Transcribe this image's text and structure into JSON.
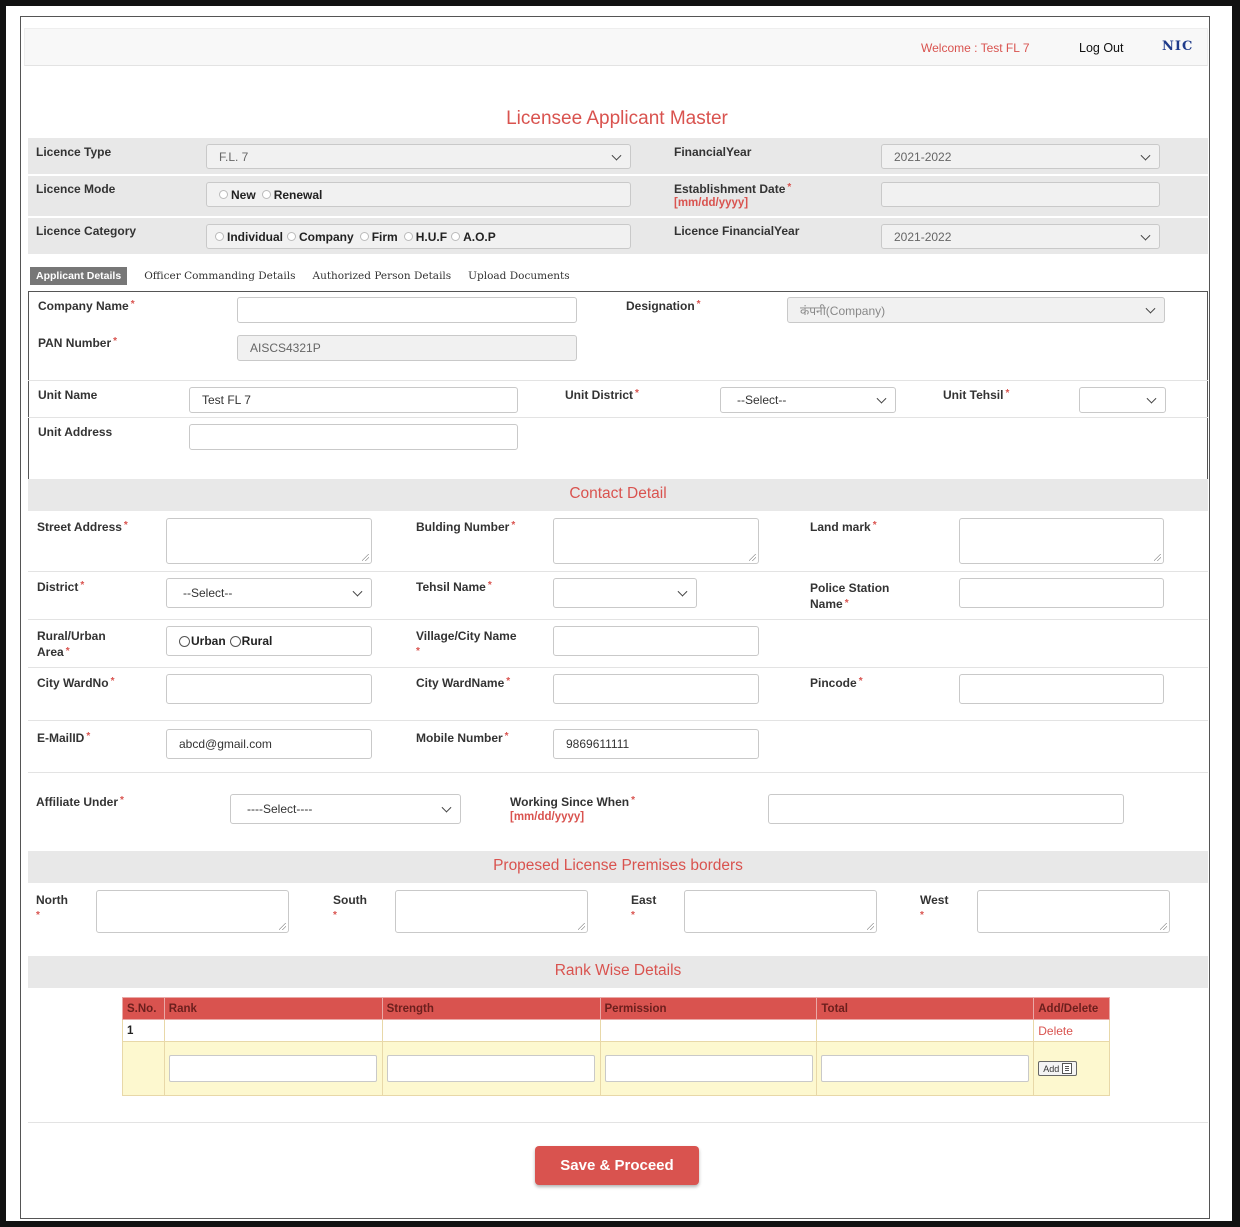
{
  "header": {
    "welcome": "Welcome : Test FL 7",
    "logout": "Log Out",
    "logo": "NIC"
  },
  "page_title": "Licensee Applicant Master",
  "top_form": {
    "licence_type_label": "Licence Type",
    "licence_type_value": "F.L. 7",
    "financial_year_label": "FinancialYear",
    "financial_year_value": "2021-2022",
    "licence_mode_label": "Licence Mode",
    "licence_mode_options": [
      "New",
      "Renewal"
    ],
    "establishment_date_label": "Establishment Date",
    "date_format": "[mm/dd/yyyy]",
    "licence_category_label": "Licence Category",
    "licence_category_options": [
      "Individual",
      "Company",
      "Firm",
      "H.U.F",
      "A.O.P"
    ],
    "licence_fy_label": "Licence FinancialYear",
    "licence_fy_value": "2021-2022"
  },
  "tabs": [
    "Applicant Details",
    "Officer Commanding Details",
    "Authorized Person Details",
    "Upload Documents"
  ],
  "applicant": {
    "company_name_label": "Company Name",
    "designation_label": "Designation",
    "designation_value": "कंपनी(Company)",
    "pan_label": "PAN Number",
    "pan_value": "AISCS4321P",
    "unit_name_label": "Unit Name",
    "unit_name_value": "Test FL 7",
    "unit_district_label": "Unit District",
    "unit_district_value": "--Select--",
    "unit_tehsil_label": "Unit Tehsil",
    "unit_address_label": "Unit Address"
  },
  "contact": {
    "heading": "Contact Detail",
    "street_label": "Street Address",
    "building_label": "Bulding Number",
    "landmark_label": "Land mark",
    "district_label": "District",
    "district_value": "--Select--",
    "tehsil_label": "Tehsil Name",
    "police_label_1": "Police Station",
    "police_label_2": "Name",
    "rural_label_1": "Rural/Urban",
    "rural_label_2": "Area",
    "area_options": [
      "Urban",
      "Rural"
    ],
    "village_label": "Village/City Name",
    "ward_no_label": "City WardNo",
    "ward_name_label": "City WardName",
    "pincode_label": "Pincode",
    "email_label": "E-MailID",
    "email_value": "abcd@gmail.com",
    "mobile_label": "Mobile Number",
    "mobile_value": "9869611111",
    "affiliate_label": "Affiliate Under",
    "affiliate_value": "----Select----",
    "working_since_label": "Working Since When",
    "date_format": "[mm/dd/yyyy]"
  },
  "borders": {
    "heading": "Propesed License Premises borders",
    "north": "North",
    "south": "South",
    "east": "East",
    "west": "West"
  },
  "rank": {
    "heading": "Rank Wise Details",
    "columns": [
      "S.No.",
      "Rank",
      "Strength",
      "Permission",
      "Total",
      "Add/Delete"
    ],
    "row_sno": "1",
    "delete_label": "Delete",
    "add_label": "Add"
  },
  "save_label": "Save & Proceed",
  "colors": {
    "accent": "#d9534f",
    "header_bg": "#e8e8e8",
    "table_row_bg": "#fdf8cf"
  }
}
